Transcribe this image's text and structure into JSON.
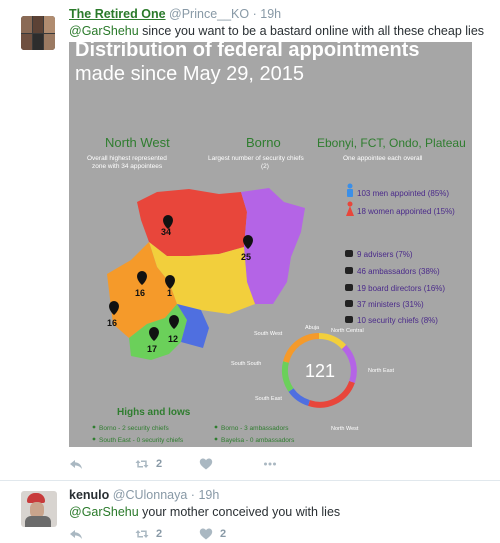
{
  "tweet1": {
    "name": "The Retired One",
    "handle": "@Prince__KO",
    "dot": "·",
    "time": "19h",
    "mention": "@GarShehu",
    "body": " since you want to be a bastard online with all these cheap lies",
    "retweet_count": "2",
    "icons": [
      "reply-icon",
      "retweet-icon",
      "like-icon",
      "more-icon"
    ],
    "infographic": {
      "title_line1": "Distribution of federal appointments",
      "title_line2": "made since May 29, 2015",
      "col1_title": "North West",
      "col1_sub1": "Overall highest represented",
      "col1_sub2": "zone with 34 appointees",
      "col2_title": "Borno",
      "col2_sub1": "Largest number of security chiefs",
      "col2_sub2": "(2)",
      "col3_title": "Ebonyi, FCT, Ondo, Plateau",
      "col3_sub1": "One appointee each overall",
      "men": "103 men appointed (85%)",
      "women": "18 women appointed (15%)",
      "advisers": "9 advisers (7%)",
      "ambassadors": "46 ambassadors (38%)",
      "board": "19 board directors (16%)",
      "ministers": "37 ministers (31%)",
      "security": "10 security chiefs (8%)",
      "map_labels": [
        "34",
        "25",
        "16",
        "1",
        "16",
        "17",
        "12"
      ],
      "ring_total": "121",
      "ring_labels": [
        "Abuja",
        "North Central",
        "North East",
        "North West",
        "South East",
        "South South",
        "South West"
      ],
      "hl_title": "Highs and lows",
      "hl1": "Borno - 2 security chiefs",
      "hl2": "South East - 0 security chiefs",
      "hl3": "Borno - 3 ambassadors",
      "hl4": "Bayelsa - 0 ambassadors",
      "colors": {
        "north_west": "#e8463b",
        "north_east": "#b464e6",
        "north_central": "#f2cf3c",
        "south_west": "#f59a2a",
        "south_east": "#4f6fe0",
        "south_south": "#6bd05a",
        "accent_green": "#2f7d2f"
      }
    }
  },
  "tweet2": {
    "name": "kenulo",
    "handle": "@CUlonnaya",
    "dot": "·",
    "time": "19h",
    "mention": "@GarShehu",
    "body": " your mother conceived you with lies",
    "retweet_count": "2",
    "like_count": "2"
  }
}
